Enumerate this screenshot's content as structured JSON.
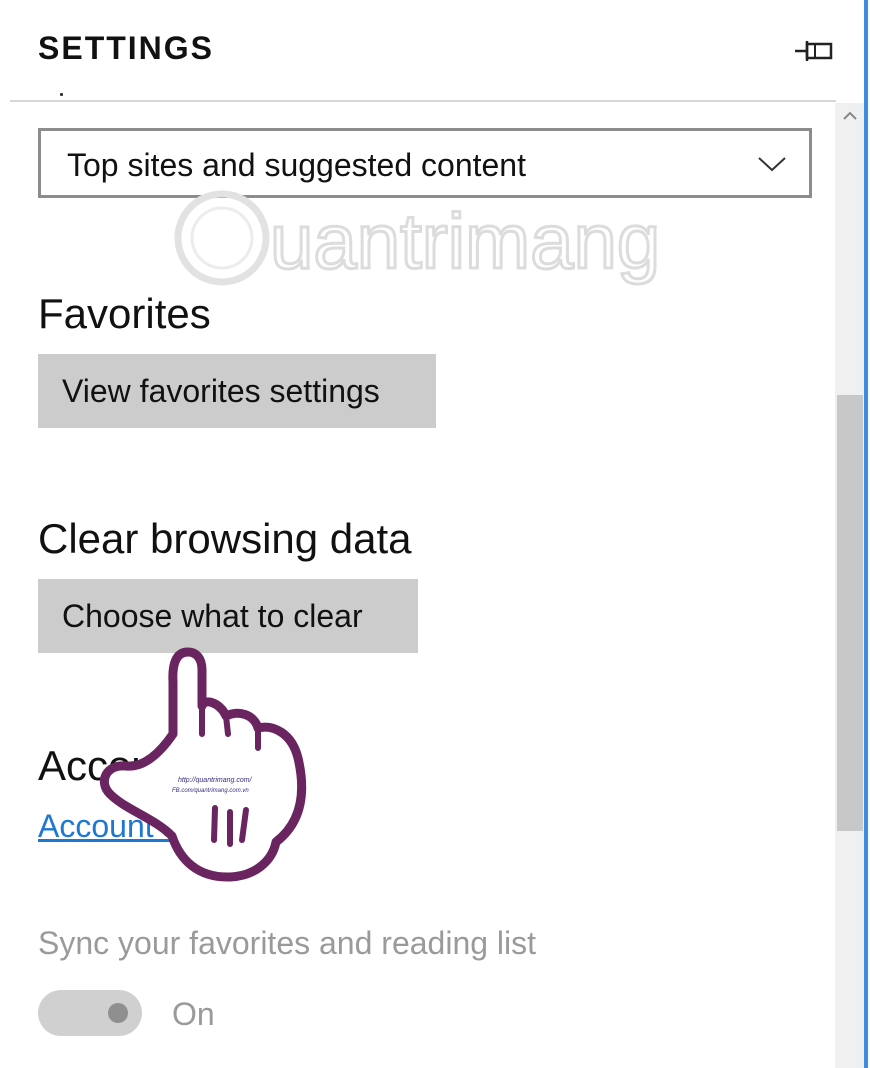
{
  "header": {
    "title": "SETTINGS",
    "pin_icon": "pin-icon"
  },
  "start_page": {
    "dropdown_value": "Top sites and suggested content",
    "dropdown_icon": "chevron-down-icon"
  },
  "favorites": {
    "heading": "Favorites",
    "button_label": "View favorites settings"
  },
  "clear_data": {
    "heading": "Clear browsing data",
    "button_label": "Choose what to clear"
  },
  "account": {
    "heading": "Account",
    "link_label": "Account settings"
  },
  "sync": {
    "label": "Sync your favorites and reading list",
    "toggle_state": "On",
    "toggle_on": true
  },
  "watermark": {
    "text": "uantrimang"
  },
  "overlay": {
    "hand_icon": "pointing-hand-icon",
    "hand_text_1": "http://quantrimang.com/",
    "hand_text_2": "FB.com/quantrimang.com.vn"
  },
  "colors": {
    "accent": "#1e78d2",
    "button_bg": "#cccccc",
    "border": "#8c8c8c",
    "hand_outline": "#6a2560",
    "window_edge": "#3c8ee0"
  }
}
